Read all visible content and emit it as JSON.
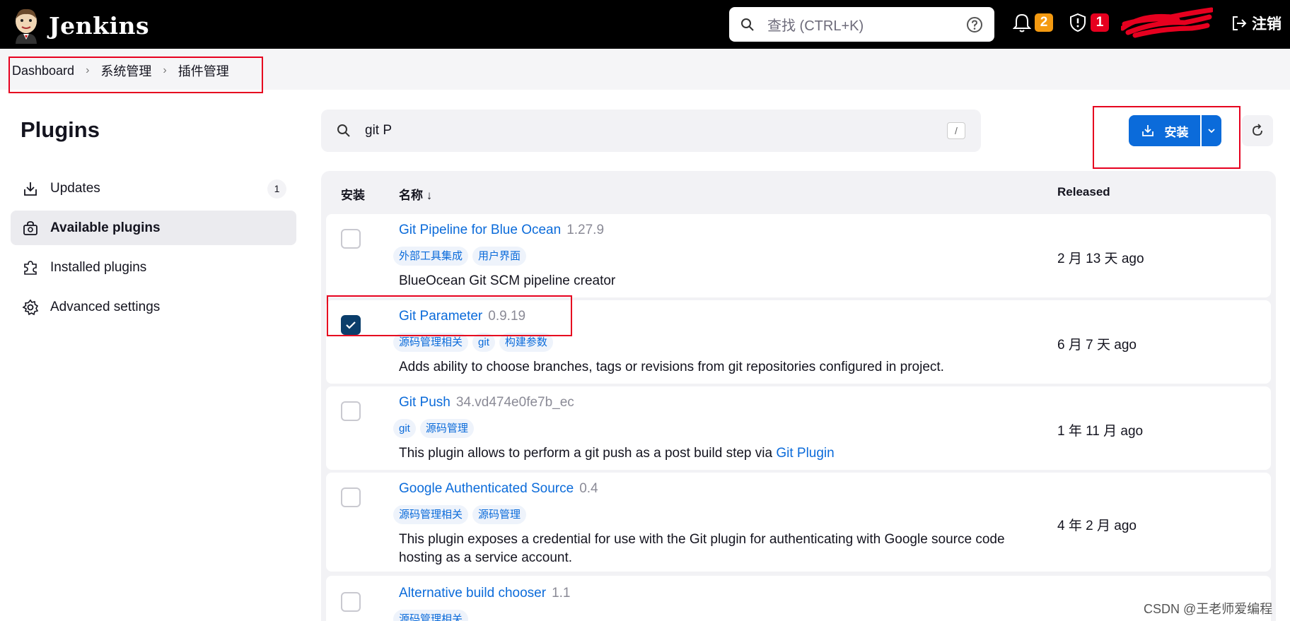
{
  "header": {
    "brand": "Jenkins",
    "search_placeholder": "查找 (CTRL+K)",
    "notifications_count": "2",
    "security_count": "1",
    "logout_label": "注销"
  },
  "breadcrumb": [
    "Dashboard",
    "系统管理",
    "插件管理"
  ],
  "sidebar": {
    "title": "Plugins",
    "items": [
      {
        "label": "Updates",
        "count": "1"
      },
      {
        "label": "Available plugins"
      },
      {
        "label": "Installed plugins"
      },
      {
        "label": "Advanced settings"
      }
    ]
  },
  "plugin_search": {
    "value": "git P",
    "shortcut": "/"
  },
  "actions": {
    "install_label": "安装"
  },
  "table": {
    "headers": {
      "install": "安装",
      "name": "名称 ↓",
      "released": "Released"
    },
    "rows": [
      {
        "name": "Git Pipeline for Blue Ocean",
        "version": "1.27.9",
        "tags": [
          "外部工具集成",
          "用户界面"
        ],
        "description": "BlueOcean Git SCM pipeline creator",
        "released": "2 月 13 天 ago",
        "checked": false
      },
      {
        "name": "Git Parameter",
        "version": "0.9.19",
        "tags": [
          "源码管理相关",
          "git",
          "构建参数"
        ],
        "description": "Adds ability to choose branches, tags or revisions from git repositories configured in project.",
        "released": "6 月 7 天 ago",
        "checked": true
      },
      {
        "name": "Git Push",
        "version": "34.vd474e0fe7b_ec",
        "tags": [
          "git",
          "源码管理"
        ],
        "description": "This plugin allows to perform a git push as a post build step via ",
        "description_link": "Git Plugin",
        "released": "1 年 11 月 ago",
        "checked": false
      },
      {
        "name": "Google Authenticated Source",
        "version": "0.4",
        "tags": [
          "源码管理相关",
          "源码管理"
        ],
        "description": "This plugin exposes a credential for use with the Git plugin for authenticating with Google source code hosting as a service account.",
        "released": "4 年 2 月 ago",
        "checked": false
      },
      {
        "name": "Alternative build chooser",
        "version": "1.1",
        "tags": [
          "源码管理相关"
        ],
        "description": "",
        "released": "",
        "checked": false
      }
    ]
  },
  "watermark": "CSDN @王老师爱编程",
  "colors": {
    "accent": "#0b6bda",
    "highlight_box": "#e6001f",
    "checked": "#0b3e6b"
  }
}
